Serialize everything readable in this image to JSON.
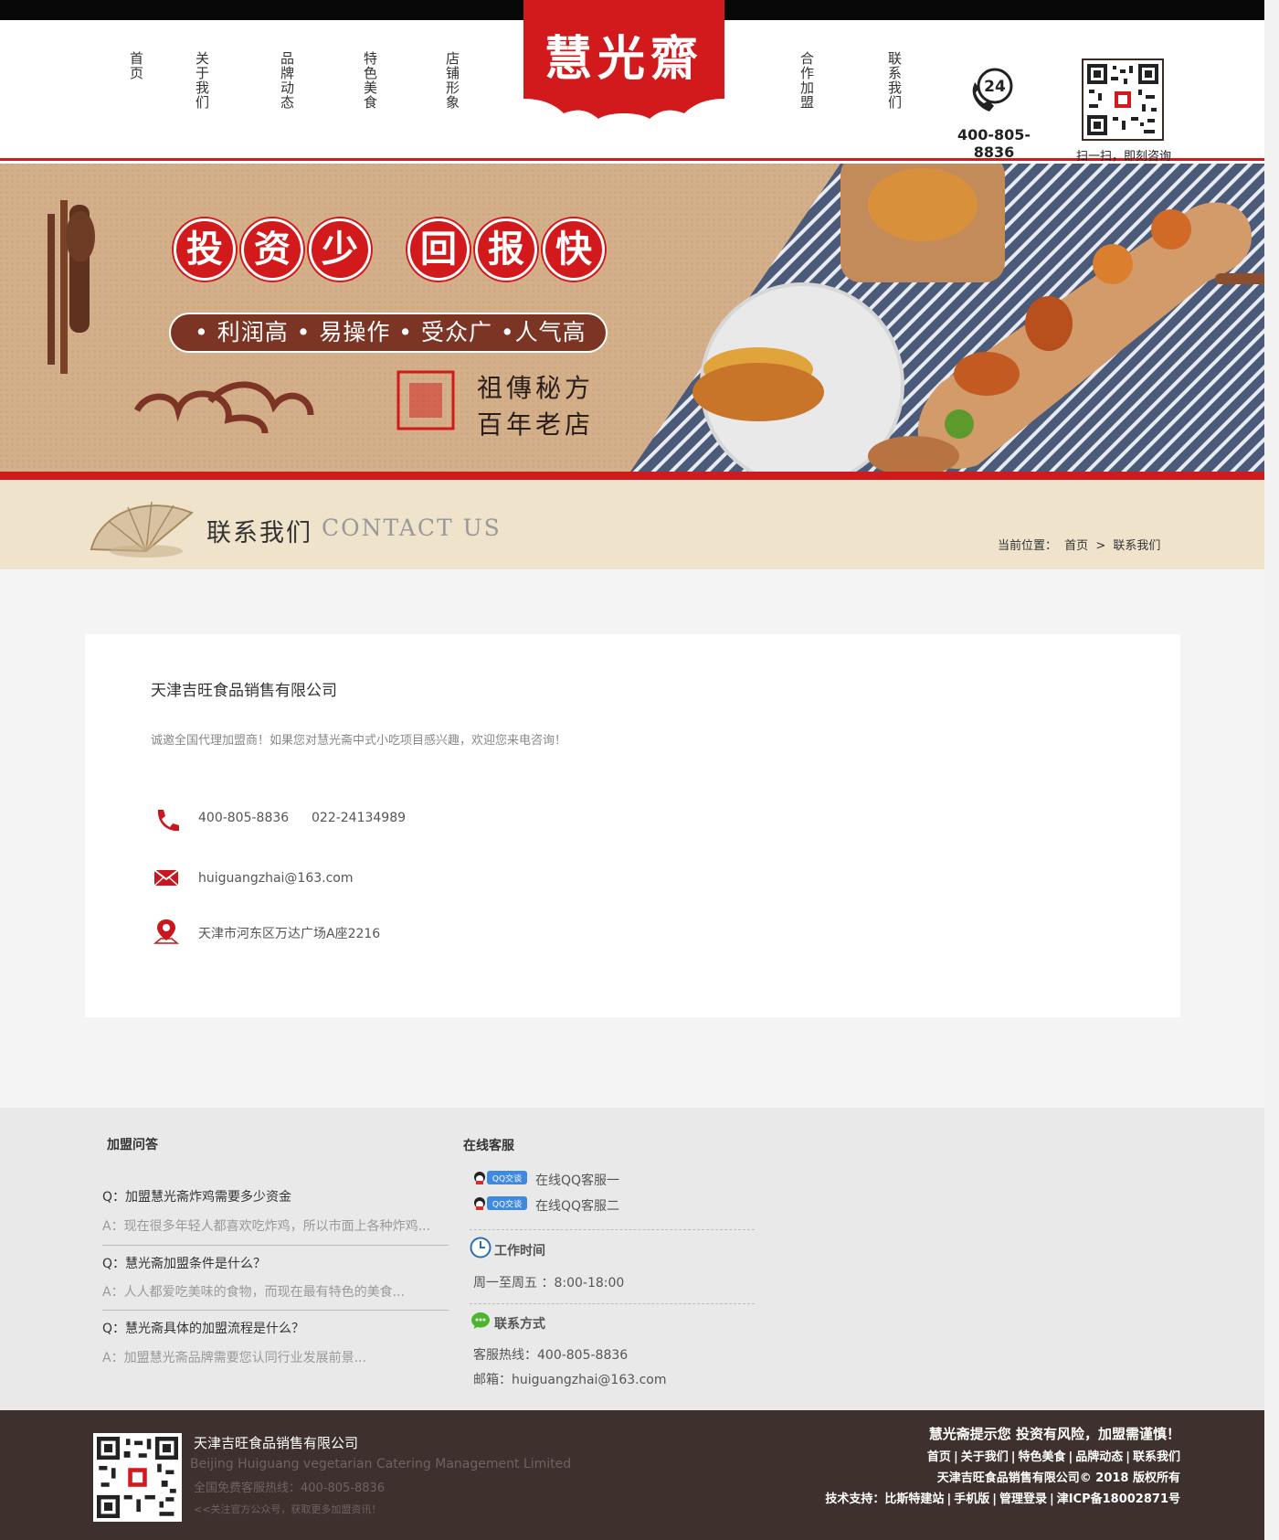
{
  "brand": {
    "logo_text": "慧光齋",
    "red": "#d2191b",
    "dark": "#3d302d"
  },
  "nav": {
    "left": [
      "首页",
      "关于我们",
      "品牌动态",
      "特色美食",
      "店铺形象"
    ],
    "right": [
      "合作加盟",
      "联系我们"
    ]
  },
  "header": {
    "phone_icon_label": "24",
    "phone": "400-805-8836",
    "qr_caption": "扫一扫，即刻咨询"
  },
  "banner": {
    "badges_left": [
      "投",
      "资",
      "少"
    ],
    "badges_right": [
      "回",
      "报",
      "快"
    ],
    "pill": "• 利润高 • 易操作 • 受众广  •人气高",
    "slogan_line1": "祖傳秘方",
    "slogan_line2": "百年老店"
  },
  "page_title": {
    "cn": "联系我们",
    "en": "CONTACT  US",
    "breadcrumb_label": "当前位置：",
    "breadcrumb_home": "首页",
    "breadcrumb_sep": ">",
    "breadcrumb_current": "联系我们"
  },
  "contact": {
    "company": "天津吉旺食品销售有限公司",
    "intro": "诚邀全国代理加盟商！如果您对慧光斋中式小吃项目感兴趣，欢迎您来电咨询！",
    "phone1": "400-805-8836",
    "phone2": "022-24134989",
    "email": "huiguangzhai@163.com",
    "address": "天津市河东区万达广场A座2216",
    "icons": [
      "phone-icon",
      "mail-icon",
      "location-pin-icon"
    ]
  },
  "footer_info": {
    "faq_heading": "加盟问答",
    "faq": [
      {
        "q": "Q：加盟慧光斋炸鸡需要多少资金",
        "a": "A：现在很多年轻人都喜欢吃炸鸡，所以市面上各种炸鸡..."
      },
      {
        "q": "Q：慧光斋加盟条件是什么？",
        "a": "A：人人都爱吃美味的食物，而现在最有特色的美食..."
      },
      {
        "q": "Q：慧光斋具体的加盟流程是什么？",
        "a": "A：加盟慧光斋品牌需要您认同行业发展前景..."
      }
    ],
    "service_heading": "在线客服",
    "qq_badge": "QQ交谈",
    "qq": [
      "在线QQ客服一",
      "在线QQ客服二"
    ],
    "work_heading": "工作时间",
    "work_hours": "周一至周五 ：8:00-18:00",
    "contact_heading": "联系方式",
    "hotline": "客服热线：400-805-8836",
    "email": "邮箱：huiguangzhai@163.com"
  },
  "bottom": {
    "company": "天津吉旺食品销售有限公司",
    "company_en": "Beijing Huiguang vegetarian Catering Management Limited",
    "hotline": "全国免费客服热线：400-805-8836",
    "follow": "<<关注官方公众号，获取更多加盟资讯！",
    "warning": "慧光斋提示您 投资有风险，加盟需谨慎！",
    "links": [
      "首页",
      "关于我们",
      "特色美食",
      "品牌动态",
      "联系我们"
    ],
    "copyright": "天津吉旺食品销售有限公司© 2018  版权所有",
    "tech_label": "技术支持：",
    "tech_links": [
      "比斯特建站",
      "手机版",
      "管理登录",
      "津ICP备18002871号"
    ]
  }
}
